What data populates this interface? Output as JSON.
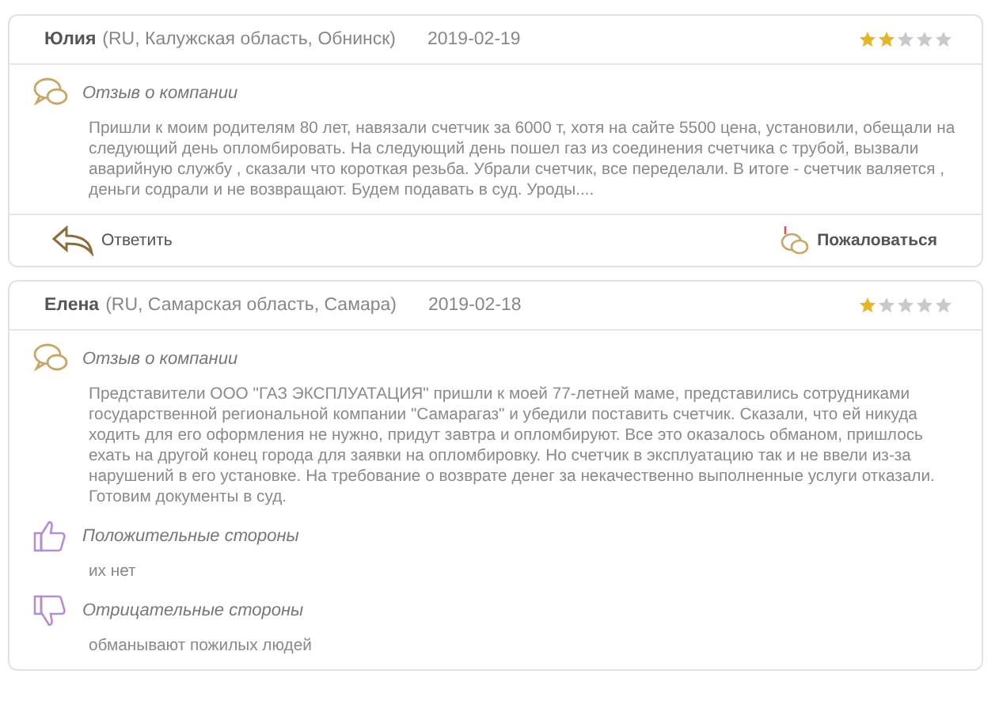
{
  "reviews": [
    {
      "author": "Юлия",
      "location": "(RU, Калужская область, Обнинск)",
      "date": "2019-02-19",
      "stars": 2,
      "sections": [
        {
          "kind": "comment",
          "title": "Отзыв о компании",
          "text": "Пришли к моим родителям 80 лет, навязали счетчик за 6000 т, хотя на сайте 5500 цена, установили, обещали на следующий день опломбировать. На следующий день пошел газ из соединения счетчика с трубой, вызвали аварийную службу , сказали что короткая резьба. Убрали счетчик, все переделали. В итоге - счетчик валяется , деньги содрали и не возвращают. Будем подавать в суд. Уроды...."
        }
      ],
      "actions": {
        "reply": "Ответить",
        "complain": "Пожаловаться"
      }
    },
    {
      "author": "Елена",
      "location": "(RU, Самарская область, Самара)",
      "date": "2019-02-18",
      "stars": 1,
      "sections": [
        {
          "kind": "comment",
          "title": "Отзыв о компании",
          "text": "Представители ООО \"ГАЗ ЭКСПЛУАТАЦИЯ\" пришли к моей 77-летней маме, представились сотрудниками государственной региональной компании \"Самарагаз\" и убедили поставить счетчик. Сказали, что ей никуда ходить для его оформления не нужно, придут завтра и опломбируют. Все это оказалось обманом, пришлось ехать на другой конец города для заявки на опломбировку. Но счетчик в эксплуатацию так и не ввели из-за нарушений в его установке. На требование о возврате денег за некачественно выполненные услуги отказали. Готовим документы в суд."
        },
        {
          "kind": "pros",
          "title": "Положительные стороны",
          "text": "их нет"
        },
        {
          "kind": "cons",
          "title": "Отрицательные стороны",
          "text": "обманывают пожилых людей"
        }
      ]
    }
  ]
}
